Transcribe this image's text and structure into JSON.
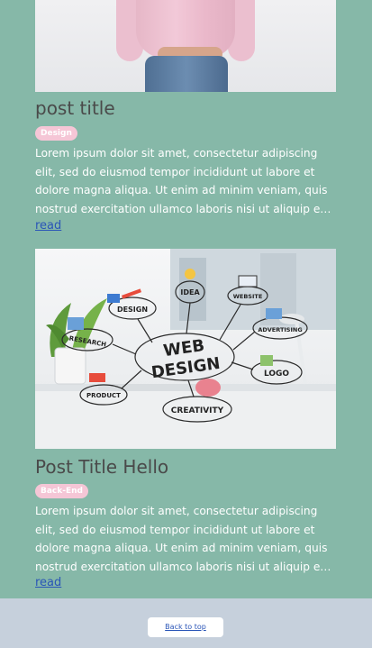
{
  "posts": [
    {
      "title": "post title",
      "tag": "Design",
      "excerpt": "Lorem ipsum dolor sit amet, consectetur adipiscing elit, sed do eiusmod tempor incididunt ut labore et dolore magna aliqua. Ut enim ad minim veniam, quis nostrud exercitation ullamco laboris nisi ut aliquip ex ea commodo consequat.",
      "read_label": "read"
    },
    {
      "title": "Post Title Hello",
      "tag": "Back-End",
      "excerpt": "Lorem ipsum dolor sit amet, consectetur adipiscing elit, sed do eiusmod tempor incididunt ut labore et dolore magna aliqua. Ut enim ad minim veniam, quis nostrud exercitation ullamco laboris nisi ut aliquip ex ea commodo consequat.",
      "read_label": "read",
      "image_words": {
        "main": [
          "WEB",
          "DESIGN"
        ],
        "nodes": [
          "DESIGN",
          "IDEA",
          "WEBSITE",
          "RESEARCH",
          "ADVERTISING",
          "PRODUCT",
          "LOGO",
          "CREATIVITY"
        ]
      }
    }
  ],
  "footer": {
    "back_to_top": "Back to top"
  },
  "colors": {
    "page_bg": "#86b8a8",
    "badge_bg": "#f5c6d6",
    "footer_bg": "#c6d0dc",
    "link": "#2a55b7"
  }
}
